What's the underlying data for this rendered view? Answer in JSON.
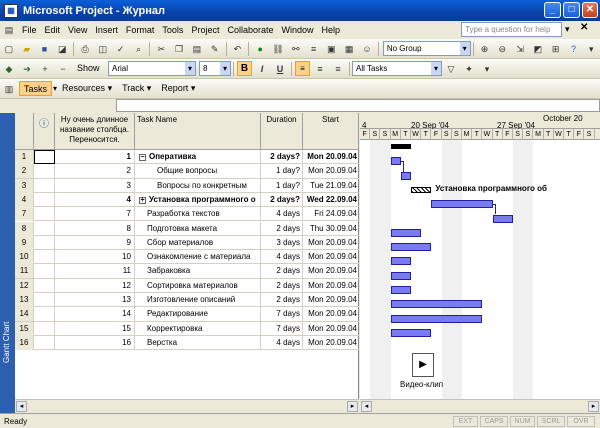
{
  "window": {
    "title": "Microsoft Project - Журнал"
  },
  "menu": [
    "File",
    "Edit",
    "View",
    "Insert",
    "Format",
    "Tools",
    "Project",
    "Collaborate",
    "Window",
    "Help"
  ],
  "help_placeholder": "Type a question for help",
  "toolbar": {
    "group": "No Group",
    "show": "Show",
    "font": "Arial",
    "size": "8",
    "filter": "All Tasks"
  },
  "guide": [
    "Tasks",
    "Resources",
    "Track",
    "Report"
  ],
  "columns": {
    "info": "ⓘ",
    "id_header": "Ну очень длинное название столбца. Переносится.",
    "name": "Task Name",
    "duration": "Duration",
    "start": "Start"
  },
  "rows": [
    {
      "rn": "1",
      "id": "1",
      "name": "Оперативка",
      "dur": "2 days?",
      "start": "Mon 20.09.04",
      "summary": true,
      "expand": "−"
    },
    {
      "rn": "2",
      "id": "2",
      "name": "Общие вопросы",
      "dur": "1 day?",
      "start": "Mon 20.09.04",
      "indent": 2
    },
    {
      "rn": "3",
      "id": "3",
      "name": "Вопросы по конкретным",
      "dur": "1 day?",
      "start": "Tue 21.09.04",
      "indent": 2
    },
    {
      "rn": "4",
      "id": "4",
      "name": "Установка программного о",
      "dur": "2 days?",
      "start": "Wed 22.09.04",
      "summary": true,
      "expand": "+"
    },
    {
      "rn": "7",
      "id": "7",
      "name": "Разработка текстов",
      "dur": "4 days",
      "start": "Fri 24.09.04",
      "indent": 1
    },
    {
      "rn": "8",
      "id": "8",
      "name": "Подготовка макета",
      "dur": "2 days",
      "start": "Thu 30.09.04",
      "indent": 1
    },
    {
      "rn": "9",
      "id": "9",
      "name": "Сбор материалов",
      "dur": "3 days",
      "start": "Mon 20.09.04",
      "indent": 1
    },
    {
      "rn": "10",
      "id": "10",
      "name": "Ознакомление с материала",
      "dur": "4 days",
      "start": "Mon 20.09.04",
      "indent": 1
    },
    {
      "rn": "11",
      "id": "11",
      "name": "Забраковка",
      "dur": "2 days",
      "start": "Mon 20.09.04",
      "indent": 1
    },
    {
      "rn": "12",
      "id": "12",
      "name": "Сортировка материалов",
      "dur": "2 days",
      "start": "Mon 20.09.04",
      "indent": 1
    },
    {
      "rn": "13",
      "id": "13",
      "name": "Изготовление описаний",
      "dur": "2 days",
      "start": "Mon 20.09.04",
      "indent": 1
    },
    {
      "rn": "14",
      "id": "14",
      "name": "Редактирование",
      "dur": "7 days",
      "start": "Mon 20.09.04",
      "indent": 1
    },
    {
      "rn": "15",
      "id": "15",
      "name": "Корректировка",
      "dur": "7 days",
      "start": "Mon 20.09.04",
      "indent": 1
    },
    {
      "rn": "16",
      "id": "16",
      "name": "Верстка",
      "dur": "4 days",
      "start": "Mon 20.09.04",
      "indent": 1
    }
  ],
  "gantt": {
    "months": [
      "4",
      "20 Sep '04",
      "27 Sep '04",
      "October 20"
    ],
    "days": [
      "F",
      "S",
      "S",
      "M",
      "T",
      "W",
      "T",
      "F",
      "S",
      "S",
      "M",
      "T",
      "W",
      "T",
      "F",
      "S",
      "S",
      "M",
      "T",
      "W",
      "T",
      "F",
      "S"
    ],
    "summary_label": "Установка программного об",
    "object_label": "Видео-клип"
  },
  "sidebar_label": "Gantt Chart",
  "status": {
    "ready": "Ready",
    "indicators": [
      "EXT",
      "CAPS",
      "NUM",
      "SCRL",
      "OVR"
    ]
  }
}
